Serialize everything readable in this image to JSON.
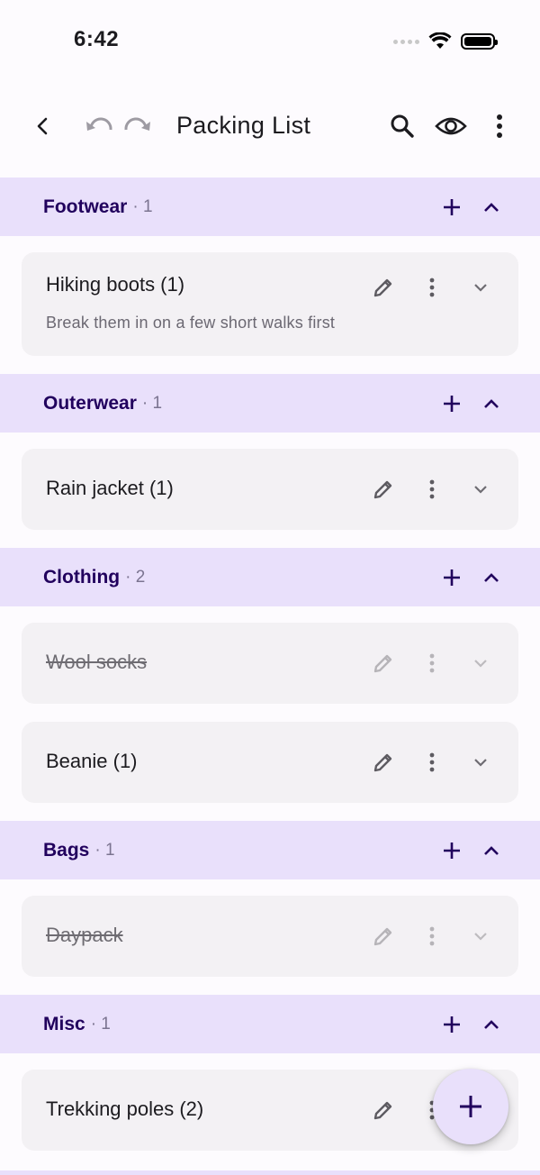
{
  "status": {
    "time": "6:42"
  },
  "app_bar": {
    "title": "Packing List"
  },
  "groups": [
    {
      "name": "Footwear",
      "count": "· 1",
      "items": [
        {
          "name": "Hiking boots (1)",
          "note": "Break them in on a few short walks first",
          "done": false
        }
      ]
    },
    {
      "name": "Outerwear",
      "count": "· 1",
      "items": [
        {
          "name": "Rain jacket (1)",
          "done": false
        }
      ]
    },
    {
      "name": "Clothing",
      "count": "· 2",
      "items": [
        {
          "name": "Wool socks",
          "done": true
        },
        {
          "name": "Beanie (1)",
          "done": false
        }
      ]
    },
    {
      "name": "Bags",
      "count": "· 1",
      "items": [
        {
          "name": "Daypack",
          "done": true
        }
      ]
    },
    {
      "name": "Misc",
      "count": "· 1",
      "items": [
        {
          "name": "Trekking poles (2)",
          "done": false
        }
      ]
    }
  ],
  "icons": {
    "back": "back-arrow-icon",
    "undo": "undo-icon",
    "redo": "redo-icon",
    "search": "search-icon",
    "visibility": "eye-icon",
    "more": "more-vert-icon",
    "add": "plus-icon",
    "collapse": "chevron-up-icon",
    "expand": "chevron-down-icon",
    "edit": "pencil-icon"
  },
  "colors": {
    "header_bg": "#e9e0fb",
    "header_text": "#21005d",
    "card_bg": "#f3f1f4",
    "fab_bg": "#e9e0fb"
  }
}
